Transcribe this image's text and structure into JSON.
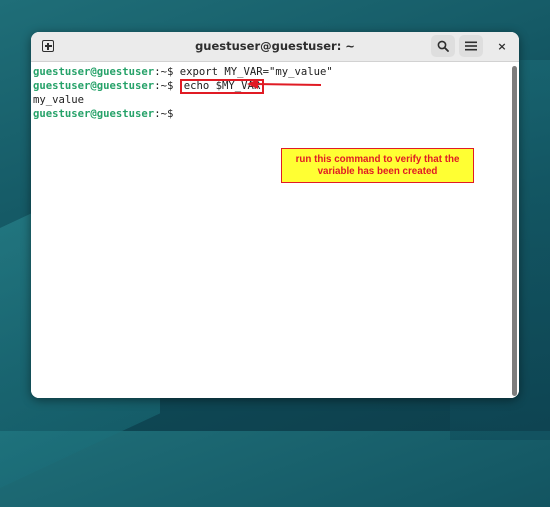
{
  "window": {
    "title": "guestuser@guestuser: ~",
    "close_glyph": "×"
  },
  "terminal": {
    "lines": [
      {
        "user": "guestuser@guestuser",
        "path": ":~$ ",
        "command": "export MY_VAR=\"my_value\""
      },
      {
        "user": "guestuser@guestuser",
        "path": ":~$ ",
        "command": "echo $MY_VAR"
      },
      {
        "output": "my_value"
      },
      {
        "user": "guestuser@guestuser",
        "path": ":~$ ",
        "command": ""
      }
    ]
  },
  "annotation": {
    "text": "run this command to verify that the variable has been created",
    "color": "#e01b24",
    "background": "#ffff33"
  },
  "colors": {
    "prompt_user": "#26a269",
    "titlebar": "#ebebeb"
  },
  "icons": [
    "new-tab-icon",
    "search-icon",
    "hamburger-menu-icon",
    "close-icon",
    "arrow-icon"
  ]
}
